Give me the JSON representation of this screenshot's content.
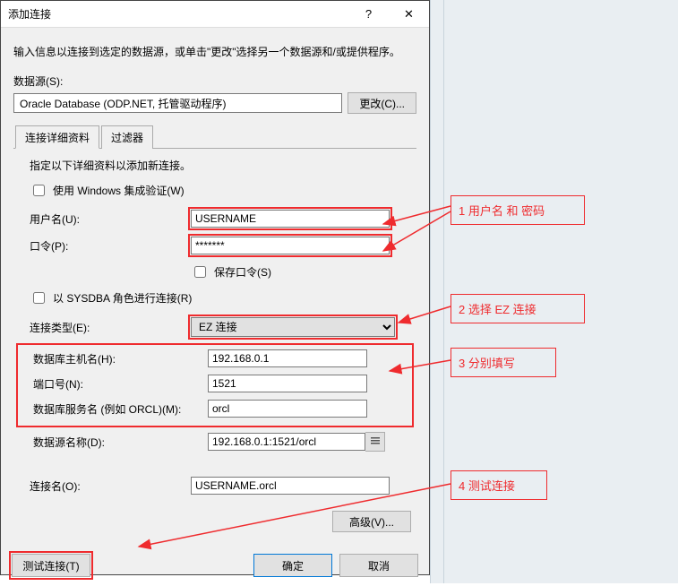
{
  "window": {
    "title": "添加连接",
    "help_icon": "?",
    "close_icon": "✕"
  },
  "instruction": "输入信息以连接到选定的数据源，或单击\"更改\"选择另一个数据源和/或提供程序。",
  "data_source_label": "数据源(S):",
  "data_source_value": "Oracle Database (ODP.NET, 托管驱动程序)",
  "change_button": "更改(C)...",
  "tabs": {
    "details": "连接详细资料",
    "filter": "过滤器"
  },
  "details": {
    "hint": "指定以下详细资料以添加新连接。",
    "use_windows_auth": "使用 Windows 集成验证(W)",
    "username_label": "用户名(U):",
    "username_value": "USERNAME",
    "password_label": "口令(P):",
    "password_value": "*******",
    "save_password": "保存口令(S)",
    "connect_as_sysdba": "以 SYSDBA 角色进行连接(R)",
    "conn_type_label": "连接类型(E):",
    "conn_type_value": "EZ 连接",
    "host_label": "数据库主机名(H):",
    "host_value": "192.168.0.1",
    "port_label": "端口号(N):",
    "port_value": "1521",
    "service_label": "数据库服务名 (例如 ORCL)(M):",
    "service_value": "orcl",
    "dsn_label": "数据源名称(D):",
    "dsn_value": "192.168.0.1:1521/orcl",
    "conn_name_label": "连接名(O):",
    "conn_name_value": "USERNAME.orcl"
  },
  "advanced_button": "高级(V)...",
  "footer": {
    "test": "测试连接(T)",
    "ok": "确定",
    "cancel": "取消"
  },
  "annotations": {
    "a1": "1 用户名 和 密码",
    "a2": "2 选择 EZ 连接",
    "a3": "3 分别填写",
    "a4": "4 测试连接"
  }
}
